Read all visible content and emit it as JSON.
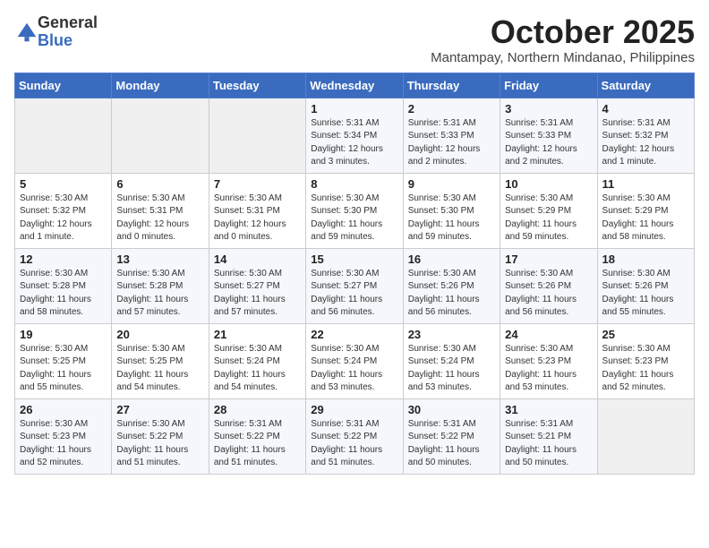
{
  "logo": {
    "general": "General",
    "blue": "Blue"
  },
  "title": "October 2025",
  "location": "Mantampay, Northern Mindanao, Philippines",
  "weekdays": [
    "Sunday",
    "Monday",
    "Tuesday",
    "Wednesday",
    "Thursday",
    "Friday",
    "Saturday"
  ],
  "weeks": [
    [
      {
        "day": "",
        "info": ""
      },
      {
        "day": "",
        "info": ""
      },
      {
        "day": "",
        "info": ""
      },
      {
        "day": "1",
        "info": "Sunrise: 5:31 AM\nSunset: 5:34 PM\nDaylight: 12 hours\nand 3 minutes."
      },
      {
        "day": "2",
        "info": "Sunrise: 5:31 AM\nSunset: 5:33 PM\nDaylight: 12 hours\nand 2 minutes."
      },
      {
        "day": "3",
        "info": "Sunrise: 5:31 AM\nSunset: 5:33 PM\nDaylight: 12 hours\nand 2 minutes."
      },
      {
        "day": "4",
        "info": "Sunrise: 5:31 AM\nSunset: 5:32 PM\nDaylight: 12 hours\nand 1 minute."
      }
    ],
    [
      {
        "day": "5",
        "info": "Sunrise: 5:30 AM\nSunset: 5:32 PM\nDaylight: 12 hours\nand 1 minute."
      },
      {
        "day": "6",
        "info": "Sunrise: 5:30 AM\nSunset: 5:31 PM\nDaylight: 12 hours\nand 0 minutes."
      },
      {
        "day": "7",
        "info": "Sunrise: 5:30 AM\nSunset: 5:31 PM\nDaylight: 12 hours\nand 0 minutes."
      },
      {
        "day": "8",
        "info": "Sunrise: 5:30 AM\nSunset: 5:30 PM\nDaylight: 11 hours\nand 59 minutes."
      },
      {
        "day": "9",
        "info": "Sunrise: 5:30 AM\nSunset: 5:30 PM\nDaylight: 11 hours\nand 59 minutes."
      },
      {
        "day": "10",
        "info": "Sunrise: 5:30 AM\nSunset: 5:29 PM\nDaylight: 11 hours\nand 59 minutes."
      },
      {
        "day": "11",
        "info": "Sunrise: 5:30 AM\nSunset: 5:29 PM\nDaylight: 11 hours\nand 58 minutes."
      }
    ],
    [
      {
        "day": "12",
        "info": "Sunrise: 5:30 AM\nSunset: 5:28 PM\nDaylight: 11 hours\nand 58 minutes."
      },
      {
        "day": "13",
        "info": "Sunrise: 5:30 AM\nSunset: 5:28 PM\nDaylight: 11 hours\nand 57 minutes."
      },
      {
        "day": "14",
        "info": "Sunrise: 5:30 AM\nSunset: 5:27 PM\nDaylight: 11 hours\nand 57 minutes."
      },
      {
        "day": "15",
        "info": "Sunrise: 5:30 AM\nSunset: 5:27 PM\nDaylight: 11 hours\nand 56 minutes."
      },
      {
        "day": "16",
        "info": "Sunrise: 5:30 AM\nSunset: 5:26 PM\nDaylight: 11 hours\nand 56 minutes."
      },
      {
        "day": "17",
        "info": "Sunrise: 5:30 AM\nSunset: 5:26 PM\nDaylight: 11 hours\nand 56 minutes."
      },
      {
        "day": "18",
        "info": "Sunrise: 5:30 AM\nSunset: 5:26 PM\nDaylight: 11 hours\nand 55 minutes."
      }
    ],
    [
      {
        "day": "19",
        "info": "Sunrise: 5:30 AM\nSunset: 5:25 PM\nDaylight: 11 hours\nand 55 minutes."
      },
      {
        "day": "20",
        "info": "Sunrise: 5:30 AM\nSunset: 5:25 PM\nDaylight: 11 hours\nand 54 minutes."
      },
      {
        "day": "21",
        "info": "Sunrise: 5:30 AM\nSunset: 5:24 PM\nDaylight: 11 hours\nand 54 minutes."
      },
      {
        "day": "22",
        "info": "Sunrise: 5:30 AM\nSunset: 5:24 PM\nDaylight: 11 hours\nand 53 minutes."
      },
      {
        "day": "23",
        "info": "Sunrise: 5:30 AM\nSunset: 5:24 PM\nDaylight: 11 hours\nand 53 minutes."
      },
      {
        "day": "24",
        "info": "Sunrise: 5:30 AM\nSunset: 5:23 PM\nDaylight: 11 hours\nand 53 minutes."
      },
      {
        "day": "25",
        "info": "Sunrise: 5:30 AM\nSunset: 5:23 PM\nDaylight: 11 hours\nand 52 minutes."
      }
    ],
    [
      {
        "day": "26",
        "info": "Sunrise: 5:30 AM\nSunset: 5:23 PM\nDaylight: 11 hours\nand 52 minutes."
      },
      {
        "day": "27",
        "info": "Sunrise: 5:30 AM\nSunset: 5:22 PM\nDaylight: 11 hours\nand 51 minutes."
      },
      {
        "day": "28",
        "info": "Sunrise: 5:31 AM\nSunset: 5:22 PM\nDaylight: 11 hours\nand 51 minutes."
      },
      {
        "day": "29",
        "info": "Sunrise: 5:31 AM\nSunset: 5:22 PM\nDaylight: 11 hours\nand 51 minutes."
      },
      {
        "day": "30",
        "info": "Sunrise: 5:31 AM\nSunset: 5:22 PM\nDaylight: 11 hours\nand 50 minutes."
      },
      {
        "day": "31",
        "info": "Sunrise: 5:31 AM\nSunset: 5:21 PM\nDaylight: 11 hours\nand 50 minutes."
      },
      {
        "day": "",
        "info": ""
      }
    ]
  ]
}
